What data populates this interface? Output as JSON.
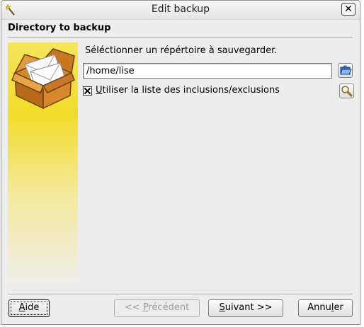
{
  "window": {
    "title": "Edit backup",
    "close_glyph": "✕"
  },
  "section": {
    "title": "Directory to backup"
  },
  "main": {
    "instruction": "Séléctionner un répértoire à sauvegarder.",
    "path_value": "/home/lise",
    "use_list_checked": true,
    "use_list_label_mnemonic": "U",
    "use_list_label_rest": "tiliser la liste des inclusions/exclusions"
  },
  "buttons": {
    "help": {
      "mnemonic": "A",
      "rest": "ide"
    },
    "previous": {
      "prefix": "<< ",
      "mnemonic": "P",
      "rest": "récédent"
    },
    "next": {
      "mnemonic": "S",
      "rest": "uivant >>"
    },
    "cancel": {
      "before": "Annu",
      "mnemonic": "l",
      "after": "er"
    }
  },
  "icons": {
    "title_icon": "wand-icon",
    "browse_icon": "folder-open-icon",
    "edit_list_icon": "magnifier-icon",
    "banner_icon": "parcel-box-icon"
  },
  "colors": {
    "window_bg": "#ededed",
    "sidebar_top": "#f1dc2a",
    "sidebar_bottom": "#f0efe8"
  }
}
